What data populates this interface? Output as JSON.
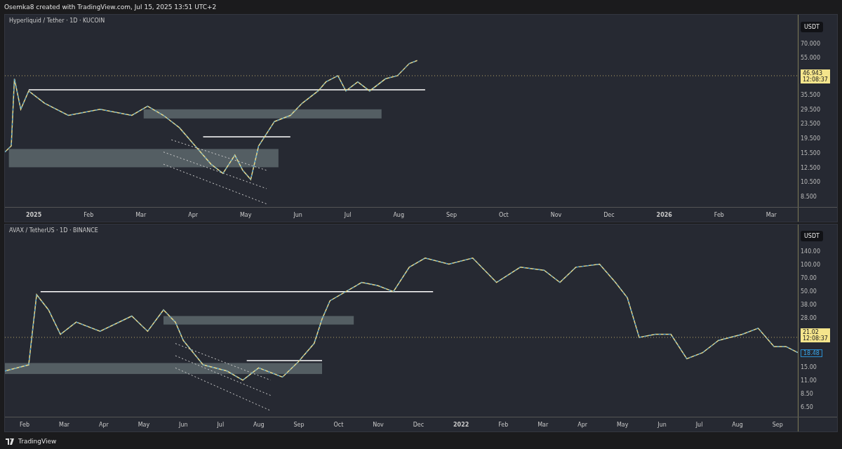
{
  "header": {
    "caption": "Osemka8 created with TradingView.com, Jul 15, 2025 13:51 UTC+2"
  },
  "panes": [
    {
      "title": "Hyperliquid / Tether · 1D · KUCOIN",
      "currency": "USDT",
      "price_axis": [
        {
          "kind": "tick",
          "text": "70.000"
        },
        {
          "kind": "tick",
          "text": "55.000"
        },
        {
          "kind": "last",
          "text": "46.943",
          "sub": "12:08:37"
        },
        {
          "kind": "tick",
          "text": "35.500"
        },
        {
          "kind": "tick",
          "text": "29.500"
        },
        {
          "kind": "tick",
          "text": "23.500"
        },
        {
          "kind": "tick",
          "text": "19.500"
        },
        {
          "kind": "tick",
          "text": "15.500"
        },
        {
          "kind": "tick",
          "text": "12.500"
        },
        {
          "kind": "tick",
          "text": "10.500"
        },
        {
          "kind": "tick",
          "text": "8.500"
        }
      ],
      "time_axis": [
        {
          "kind": "year",
          "text": "2025"
        },
        {
          "kind": "month",
          "text": "Feb"
        },
        {
          "kind": "month",
          "text": "Mar"
        },
        {
          "kind": "month",
          "text": "Apr"
        },
        {
          "kind": "month",
          "text": "May"
        },
        {
          "kind": "month",
          "text": "Jun"
        },
        {
          "kind": "month",
          "text": "Jul"
        },
        {
          "kind": "month",
          "text": "Aug"
        },
        {
          "kind": "month",
          "text": "Sep"
        },
        {
          "kind": "month",
          "text": "Oct"
        },
        {
          "kind": "month",
          "text": "Nov"
        },
        {
          "kind": "month",
          "text": "Dec"
        },
        {
          "kind": "year",
          "text": "2026"
        },
        {
          "kind": "month",
          "text": "Feb"
        },
        {
          "kind": "month",
          "text": "Mar"
        }
      ]
    },
    {
      "title": "AVAX / TetherUS · 1D · BINANCE",
      "currency": "USDT",
      "price_axis": [
        {
          "kind": "tick",
          "text": "140.00"
        },
        {
          "kind": "tick",
          "text": "100.00"
        },
        {
          "kind": "tick",
          "text": "70.00"
        },
        {
          "kind": "tick",
          "text": "50.00"
        },
        {
          "kind": "tick",
          "text": "38.00"
        },
        {
          "kind": "tick",
          "text": "28.00"
        },
        {
          "kind": "last",
          "text": "21.02",
          "sub": "12:08:37"
        },
        {
          "kind": "marker",
          "text": "18.48"
        },
        {
          "kind": "tick",
          "text": "15.00"
        },
        {
          "kind": "tick",
          "text": "11.00"
        },
        {
          "kind": "tick",
          "text": "8.50"
        },
        {
          "kind": "tick",
          "text": "6.50"
        }
      ],
      "time_axis": [
        {
          "kind": "month",
          "text": "Feb"
        },
        {
          "kind": "month",
          "text": "Mar"
        },
        {
          "kind": "month",
          "text": "Apr"
        },
        {
          "kind": "month",
          "text": "May"
        },
        {
          "kind": "month",
          "text": "Jun"
        },
        {
          "kind": "month",
          "text": "Jul"
        },
        {
          "kind": "month",
          "text": "Aug"
        },
        {
          "kind": "month",
          "text": "Sep"
        },
        {
          "kind": "month",
          "text": "Oct"
        },
        {
          "kind": "month",
          "text": "Nov"
        },
        {
          "kind": "month",
          "text": "Dec"
        },
        {
          "kind": "year",
          "text": "2022"
        },
        {
          "kind": "month",
          "text": "Feb"
        },
        {
          "kind": "month",
          "text": "Mar"
        },
        {
          "kind": "month",
          "text": "Apr"
        },
        {
          "kind": "month",
          "text": "May"
        },
        {
          "kind": "month",
          "text": "Jun"
        },
        {
          "kind": "month",
          "text": "Jul"
        },
        {
          "kind": "month",
          "text": "Aug"
        },
        {
          "kind": "month",
          "text": "Sep"
        }
      ]
    }
  ],
  "footer": {
    "brand": "TradingView"
  }
}
